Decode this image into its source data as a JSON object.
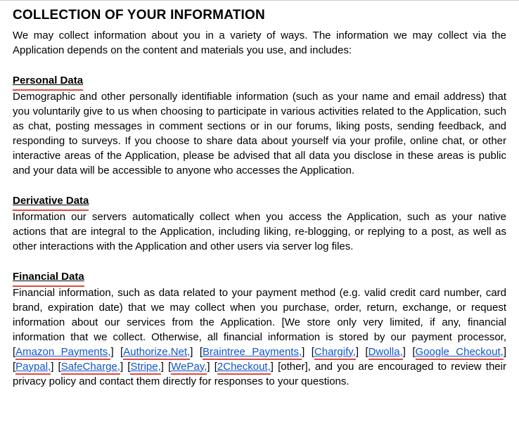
{
  "heading": "COLLECTION OF YOUR INFORMATION",
  "intro": "We may collect information about you in a variety of ways.  The information we may collect via the Application depends on the content and materials you use, and includes:",
  "sections": {
    "personal": {
      "title": "Personal Data",
      "body": "Demographic and other personally identifiable information (such as your name and email address) that you voluntarily give to us when choosing to participate in various activities related to the Application, such as chat, posting messages in comment sections or in our forums, liking posts, sending feedback, and responding to surveys.  If you choose to share data about yourself via your profile, online chat, or other interactive areas of the Application, please be advised that all data you disclose in these areas is public and your data will be accessible to anyone who accesses the Application."
    },
    "derivative": {
      "title": "Derivative Data",
      "body": "Information our servers automatically collect when you access the Application, such as your native actions that are integral to the Application, including liking, re-blogging, or replying to a post, as well as other interactions with the Application and other users via server log files."
    },
    "financial": {
      "title": "Financial Data",
      "lead": "Financial information, such as data related to your payment method (e.g. valid credit card number, card brand, expiration date) that we may collect when you purchase, order, return, exchange, or request information about our services from the Application. [We store only very limited, if any, financial information that we collect. Otherwise, all financial information is stored by our payment processor, ",
      "tail": " [other], and you are encouraged to review their privacy policy and contact them directly for responses to your questions.",
      "processors": [
        "Amazon Payments,",
        "Authorize.Net,",
        "Braintree Payments,",
        "Chargify,",
        "Dwolla,",
        "Google Checkout,",
        "Paypal,",
        "SafeCharge,",
        "Stripe,",
        "WePay,",
        "2Checkout,"
      ]
    }
  }
}
